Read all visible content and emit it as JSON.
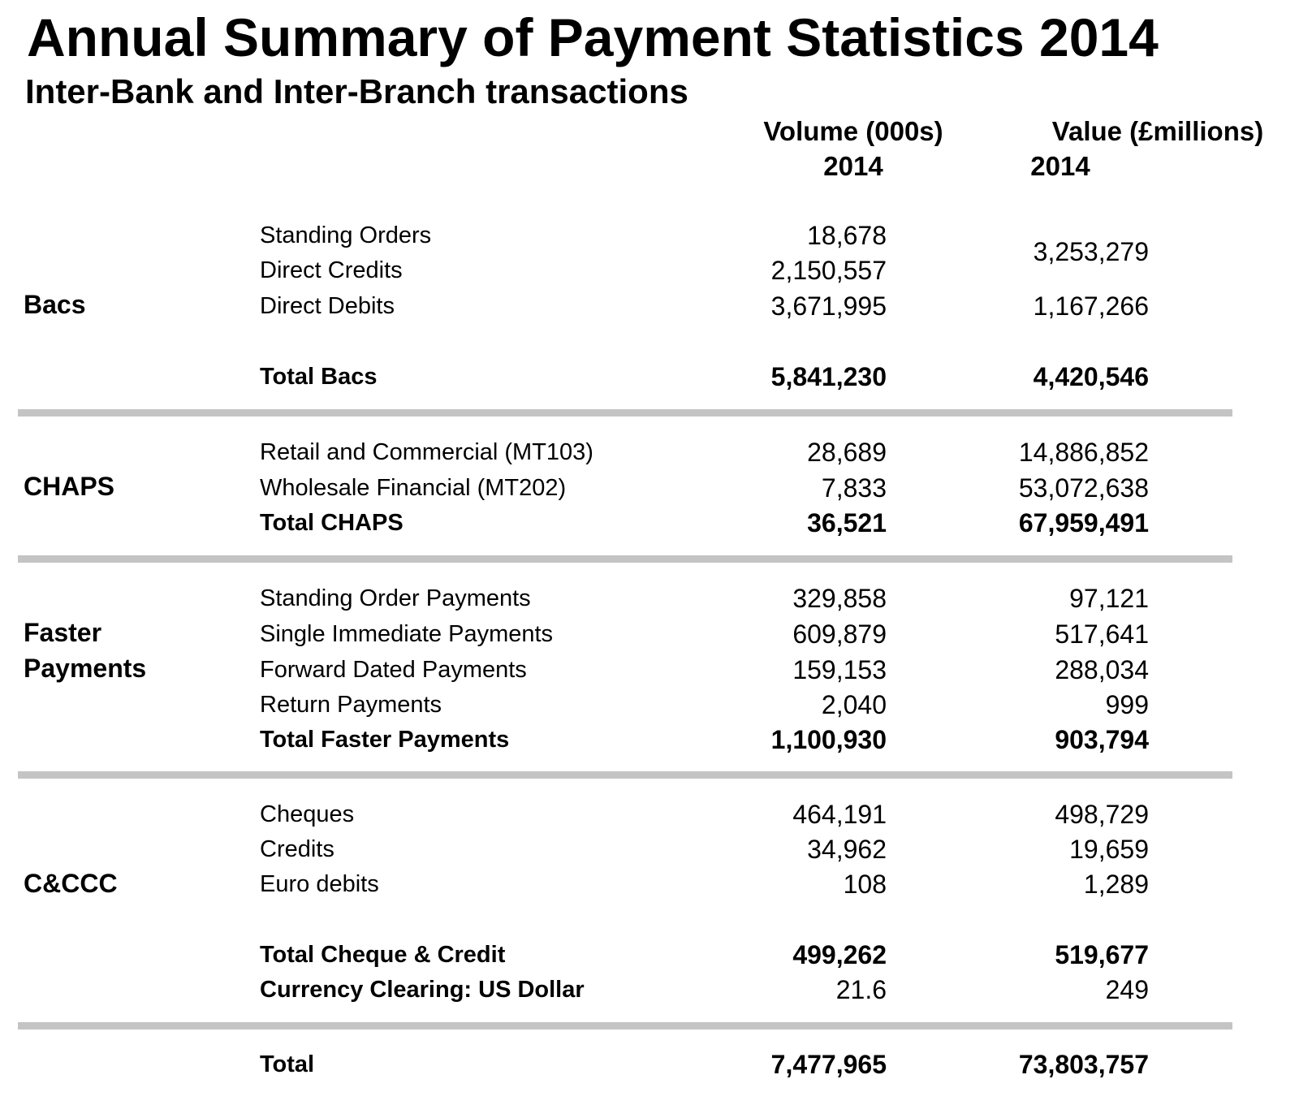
{
  "title": "Annual Summary of Payment Statistics 2014",
  "subtitle": "Inter-Bank and Inter-Branch transactions",
  "columns": {
    "volume": {
      "line1": "Volume (000s)",
      "line2": "2014"
    },
    "value": {
      "line1": "Value (£millions)",
      "line2": "2014"
    }
  },
  "bacs": {
    "label": "Bacs",
    "rows": [
      {
        "label": "Standing Orders",
        "volume": "18,678"
      },
      {
        "label": "Direct Credits",
        "volume": "2,150,557"
      },
      {
        "label": "Direct Debits",
        "volume": "3,671,995",
        "value": "1,167,266"
      }
    ],
    "shared_value": "3,253,279",
    "total": {
      "label": "Total Bacs",
      "volume": "5,841,230",
      "value": "4,420,546"
    }
  },
  "chaps": {
    "label": "CHAPS",
    "rows": [
      {
        "label": "Retail and Commercial (MT103)",
        "volume": "28,689",
        "value": "14,886,852"
      },
      {
        "label": "Wholesale Financial (MT202)",
        "volume": "7,833",
        "value": "53,072,638"
      }
    ],
    "total": {
      "label": "Total CHAPS",
      "volume": "36,521",
      "value": "67,959,491"
    }
  },
  "faster": {
    "label_line1": "Faster",
    "label_line2": "Payments",
    "rows": [
      {
        "label": "Standing Order Payments",
        "volume": "329,858",
        "value": "97,121"
      },
      {
        "label": "Single Immediate Payments",
        "volume": "609,879",
        "value": "517,641"
      },
      {
        "label": "Forward Dated Payments",
        "volume": "159,153",
        "value": "288,034"
      },
      {
        "label": "Return Payments",
        "volume": "2,040",
        "value": "999"
      }
    ],
    "total": {
      "label": "Total Faster Payments",
      "volume": "1,100,930",
      "value": "903,794"
    }
  },
  "cccc": {
    "label": "C&CCC",
    "rows": [
      {
        "label": "Cheques",
        "volume": "464,191",
        "value": "498,729"
      },
      {
        "label": "Credits",
        "volume": "34,962",
        "value": "19,659"
      },
      {
        "label": "Euro debits",
        "volume": "108",
        "value": "1,289"
      }
    ],
    "total": {
      "label": "Total Cheque & Credit",
      "volume": "499,262",
      "value": "519,677"
    },
    "currency": {
      "label": "Currency Clearing: US Dollar",
      "volume": "21.6",
      "value": "249"
    }
  },
  "grand_total": {
    "label": "Total",
    "volume": "7,477,965",
    "value": "73,803,757"
  }
}
